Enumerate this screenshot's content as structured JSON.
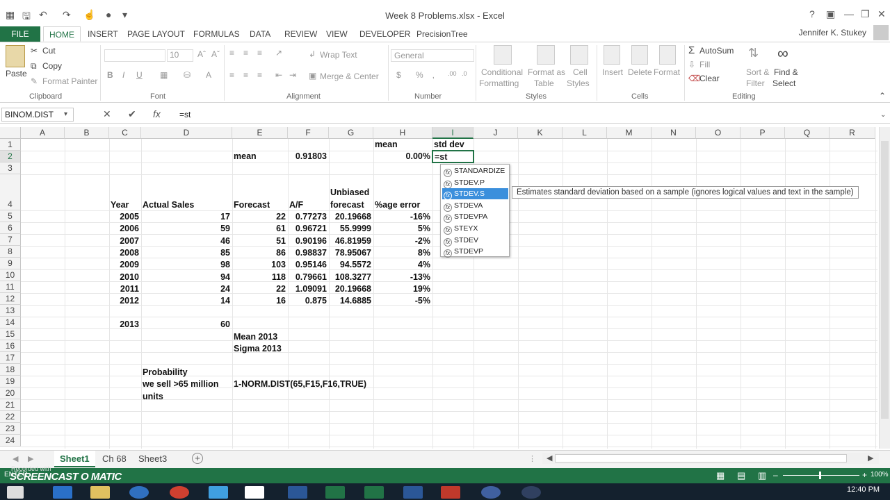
{
  "window": {
    "title": "Week 8 Problems.xlsx - Excel"
  },
  "user": "Jennifer K. Stukey",
  "tabs": [
    "FILE",
    "HOME",
    "INSERT",
    "PAGE LAYOUT",
    "FORMULAS",
    "DATA",
    "REVIEW",
    "VIEW",
    "DEVELOPER",
    "PrecisionTree"
  ],
  "ribbon": {
    "clipboard": {
      "paste": "Paste",
      "cut": "Cut",
      "copy": "Copy",
      "format_painter": "Format Painter",
      "label": "Clipboard"
    },
    "font": {
      "size": "10",
      "label": "Font"
    },
    "alignment": {
      "wrap": "Wrap Text",
      "merge": "Merge & Center",
      "label": "Alignment"
    },
    "number": {
      "format": "General",
      "label": "Number"
    },
    "styles": {
      "cond1": "Conditional",
      "cond2": "Formatting",
      "fmt1": "Format as",
      "fmt2": "Table",
      "cell1": "Cell",
      "cell2": "Styles",
      "label": "Styles"
    },
    "cells": {
      "insert": "Insert",
      "delete": "Delete",
      "format": "Format",
      "label": "Cells"
    },
    "editing": {
      "autosum": "AutoSum",
      "fill": "Fill",
      "clear": "Clear",
      "sort1": "Sort &",
      "sort2": "Filter",
      "find1": "Find &",
      "find2": "Select",
      "label": "Editing"
    }
  },
  "formula_bar": {
    "name_box": "BINOM.DIST",
    "formula": "=st"
  },
  "columns": [
    "A",
    "B",
    "C",
    "D",
    "E",
    "F",
    "G",
    "H",
    "I",
    "J",
    "K",
    "L",
    "M",
    "N",
    "O",
    "P",
    "Q",
    "R"
  ],
  "rows": [
    "1",
    "2",
    "3",
    "4",
    "5",
    "6",
    "7",
    "8",
    "9",
    "10",
    "11",
    "12",
    "13",
    "14",
    "15",
    "16",
    "17",
    "18",
    "19",
    "20",
    "21",
    "22",
    "23",
    "24"
  ],
  "cells": {
    "H1": "mean",
    "I1": "std dev",
    "E2": "mean",
    "F2": "0.91803",
    "H2": "0.00%",
    "I2": "=st",
    "G4a": "Unbiased",
    "G4b": "forecast",
    "C4": "Year",
    "D4": "Actual Sales",
    "E4": "Forecast",
    "F4": "A/F",
    "H4": "%age error",
    "data": [
      [
        "2005",
        "17",
        "22",
        "0.77273",
        "20.19668",
        "-16%"
      ],
      [
        "2006",
        "59",
        "61",
        "0.96721",
        "55.9999",
        "5%"
      ],
      [
        "2007",
        "46",
        "51",
        "0.90196",
        "46.81959",
        "-2%"
      ],
      [
        "2008",
        "85",
        "86",
        "0.98837",
        "78.95067",
        "8%"
      ],
      [
        "2009",
        "98",
        "103",
        "0.95146",
        "94.5572",
        "4%"
      ],
      [
        "2010",
        "94",
        "118",
        "0.79661",
        "108.3277",
        "-13%"
      ],
      [
        "2011",
        "24",
        "22",
        "1.09091",
        "20.19668",
        "19%"
      ],
      [
        "2012",
        "14",
        "16",
        "0.875",
        "14.6885",
        "-5%"
      ]
    ],
    "C14": "2013",
    "D14": "60",
    "E15": "Mean 2013",
    "E16": "Sigma 2013",
    "D18": "Probability",
    "D19": "we sell >65 million",
    "D20": "units",
    "E19": "1-NORM.DIST(65,F15,F16,TRUE)"
  },
  "autocomplete": {
    "items": [
      "STANDARDIZE",
      "STDEV.P",
      "STDEV.S",
      "STDEVA",
      "STDEVPA",
      "STEYX",
      "STDEV",
      "STDEVP"
    ],
    "selected_index": 2,
    "tooltip": "Estimates standard deviation based on a sample (ignores logical values and text in the sample)"
  },
  "sheets": [
    "Sheet1",
    "Ch 68",
    "Sheet3"
  ],
  "status": {
    "mode": "ENTER",
    "zoom": "100%",
    "recorded": "Recorded with",
    "brand": "SCREENCAST O MATIC",
    "time": "12:40 PM"
  }
}
